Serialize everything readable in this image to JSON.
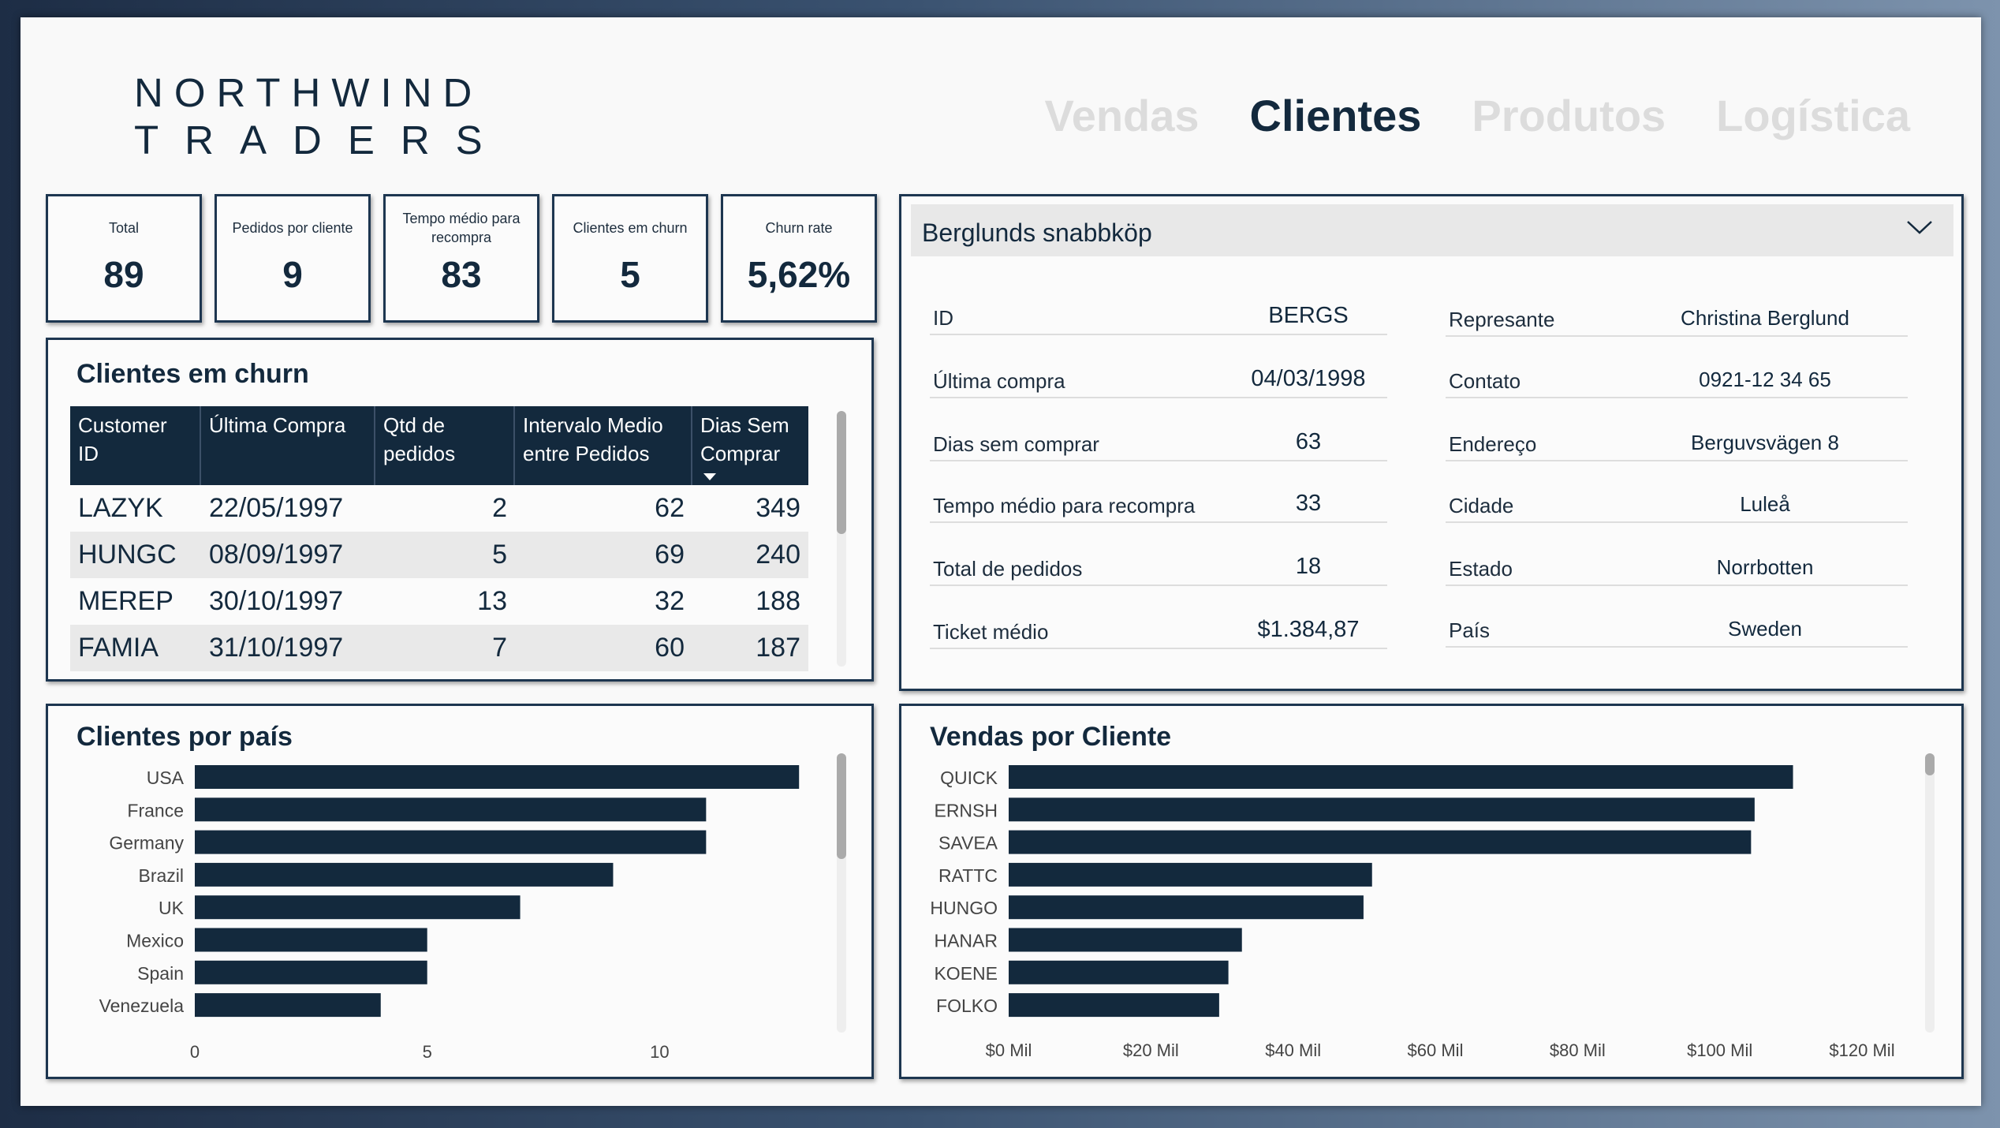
{
  "logo": {
    "line1": "NORTHWIND",
    "line2": "TRADERS"
  },
  "nav": {
    "tabs": [
      {
        "label": "Vendas",
        "active": false
      },
      {
        "label": "Clientes",
        "active": true
      },
      {
        "label": "Produtos",
        "active": false
      },
      {
        "label": "Logística",
        "active": false
      }
    ]
  },
  "kpis": [
    {
      "label": "Total",
      "value": "89"
    },
    {
      "label": "Pedidos por cliente",
      "value": "9"
    },
    {
      "label": "Tempo médio para recompra",
      "value": "83"
    },
    {
      "label": "Clientes em churn",
      "value": "5"
    },
    {
      "label": "Churn rate",
      "value": "5,62%"
    }
  ],
  "churn": {
    "title": "Clientes em churn",
    "headers": [
      "Customer ID",
      "Última Compra",
      "Qtd de pedidos",
      "Intervalo Medio entre Pedidos",
      "Dias Sem Comprar"
    ],
    "rows": [
      [
        "LAZYK",
        "22/05/1997",
        "2",
        "62",
        "349"
      ],
      [
        "HUNGC",
        "08/09/1997",
        "5",
        "69",
        "240"
      ],
      [
        "MEREP",
        "30/10/1997",
        "13",
        "32",
        "188"
      ],
      [
        "FAMIA",
        "31/10/1997",
        "7",
        "60",
        "187"
      ]
    ]
  },
  "customer": {
    "selected": "Berglunds snabbköp",
    "left": [
      {
        "label": "ID",
        "value": "BERGS"
      },
      {
        "label": "Última compra",
        "value": "04/03/1998"
      },
      {
        "label": "Dias sem comprar",
        "value": "63"
      },
      {
        "label": "Tempo médio para recompra",
        "value": "33"
      },
      {
        "label": "Total de pedidos",
        "value": "18"
      },
      {
        "label": "Ticket médio",
        "value": "$1.384,87"
      }
    ],
    "right": [
      {
        "label": "Represante",
        "value": "Christina Berglund"
      },
      {
        "label": "Contato",
        "value": "0921-12 34 65"
      },
      {
        "label": "Endereço",
        "value": "Berguvsvägen  8"
      },
      {
        "label": "Cidade",
        "value": "Luleå"
      },
      {
        "label": "Estado",
        "value": "Norrbotten"
      },
      {
        "label": "País",
        "value": "Sweden"
      }
    ]
  },
  "chart_data": [
    {
      "type": "bar",
      "orientation": "horizontal",
      "title": "Clientes por país",
      "categories": [
        "USA",
        "France",
        "Germany",
        "Brazil",
        "UK",
        "Mexico",
        "Spain",
        "Venezuela"
      ],
      "values": [
        13,
        11,
        11,
        9,
        7,
        5,
        5,
        4
      ],
      "xlim": [
        0,
        13.2
      ],
      "xticks": [
        0,
        5,
        10
      ],
      "xtick_labels": [
        "0",
        "5",
        "10"
      ],
      "color": "#13293d"
    },
    {
      "type": "bar",
      "orientation": "horizontal",
      "title": "Vendas por Cliente",
      "categories": [
        "QUICK",
        "ERNSH",
        "SAVEA",
        "RATTC",
        "HUNGO",
        "HANAR",
        "KOENE",
        "FOLKO"
      ],
      "values": [
        110.3,
        104.9,
        104.4,
        51.1,
        49.9,
        32.8,
        30.9,
        29.6
      ],
      "unit": "Mil",
      "xlim": [
        0,
        120
      ],
      "xticks": [
        0,
        20,
        40,
        60,
        80,
        100,
        120
      ],
      "xtick_labels": [
        "$0 Mil",
        "$20 Mil",
        "$40 Mil",
        "$60 Mil",
        "$80 Mil",
        "$100 Mil",
        "$120 Mil"
      ],
      "color": "#13293d"
    }
  ]
}
